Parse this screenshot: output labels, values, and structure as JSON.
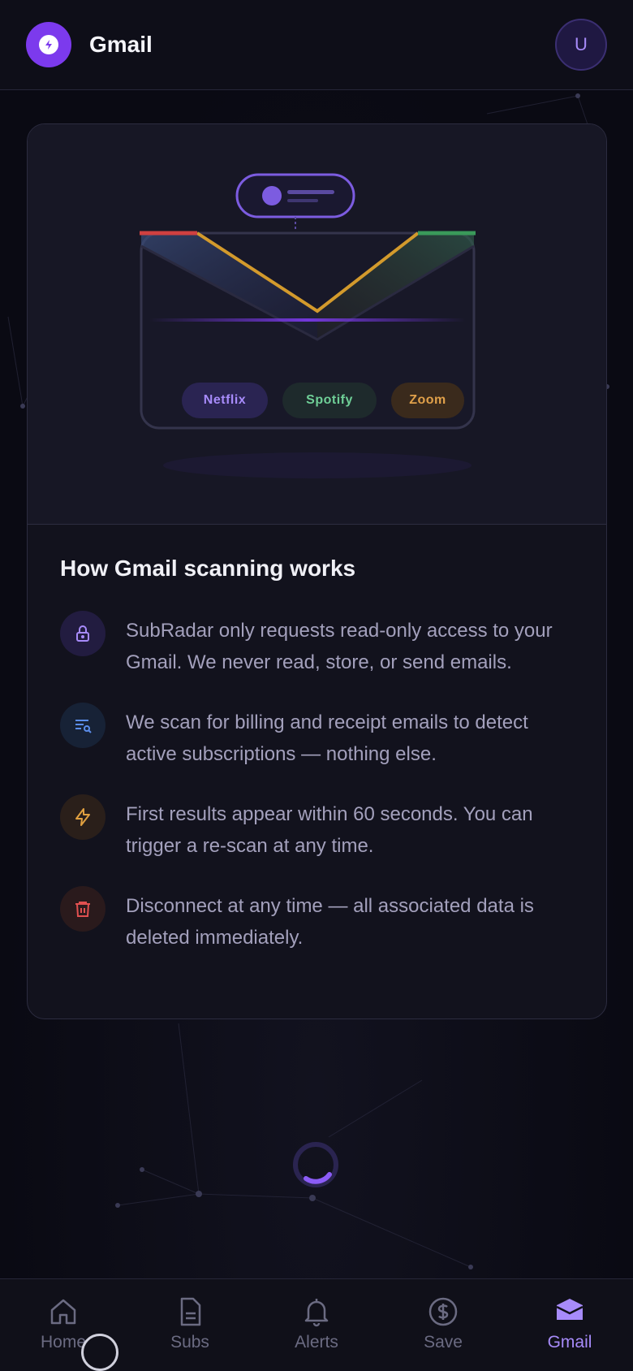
{
  "header": {
    "title": "Gmail",
    "avatar_initial": "U"
  },
  "hero": {
    "chips": [
      "Netflix",
      "Spotify",
      "Zoom"
    ]
  },
  "info": {
    "heading": "How Gmail scanning works",
    "items": [
      {
        "icon": "lock-icon",
        "text": "SubRadar only requests read-only access to your Gmail. We never read, store, or send emails."
      },
      {
        "icon": "search-list-icon",
        "text": "We scan for billing and receipt emails to detect active subscriptions — nothing else."
      },
      {
        "icon": "lightning-icon",
        "text": "First results appear within 60 seconds. You can trigger a re-scan at any time."
      },
      {
        "icon": "trash-icon",
        "text": "Disconnect at any time — all associated data is deleted immediately."
      }
    ]
  },
  "tabs": [
    {
      "label": "Home",
      "icon": "home-icon",
      "active": false
    },
    {
      "label": "Subs",
      "icon": "document-icon",
      "active": false
    },
    {
      "label": "Alerts",
      "icon": "bell-icon",
      "active": false
    },
    {
      "label": "Save",
      "icon": "dollar-icon",
      "active": false
    },
    {
      "label": "Gmail",
      "icon": "mail-icon",
      "active": true
    }
  ],
  "colors": {
    "accent": "#7c3aed",
    "accent_light": "#a78bfa",
    "background": "#0b0b14",
    "card": "#12121d"
  }
}
